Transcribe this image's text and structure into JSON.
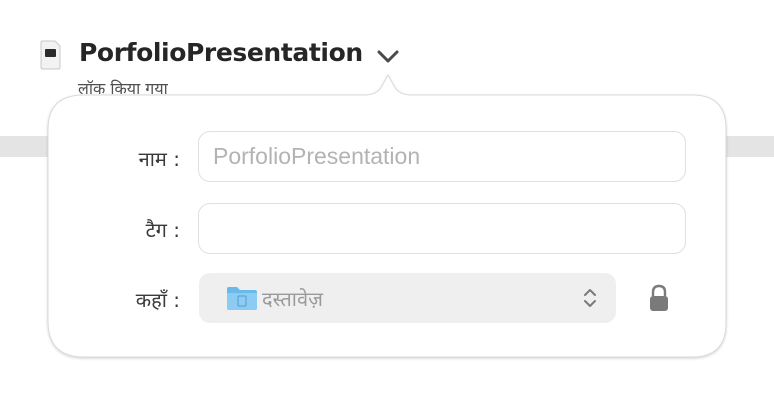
{
  "document": {
    "title": "PorfolioPresentation",
    "status": "लॉक किया गया"
  },
  "popover": {
    "name_label": "नाम :",
    "name_value": "PorfolioPresentation",
    "tags_label": "टैग :",
    "tags_value": "",
    "where_label": "कहाँ :",
    "where_value": "दस्तावेज़"
  },
  "icons": {
    "document": "document-icon",
    "title_menu": "chevron-down-icon",
    "folder": "folder-icon",
    "select": "updown-chevron-icon",
    "lock": "lock-icon"
  },
  "colors": {
    "folder_blue": "#6bb8ea",
    "field_text": "#b3b3b3",
    "popover_bg": "#ffffff"
  }
}
